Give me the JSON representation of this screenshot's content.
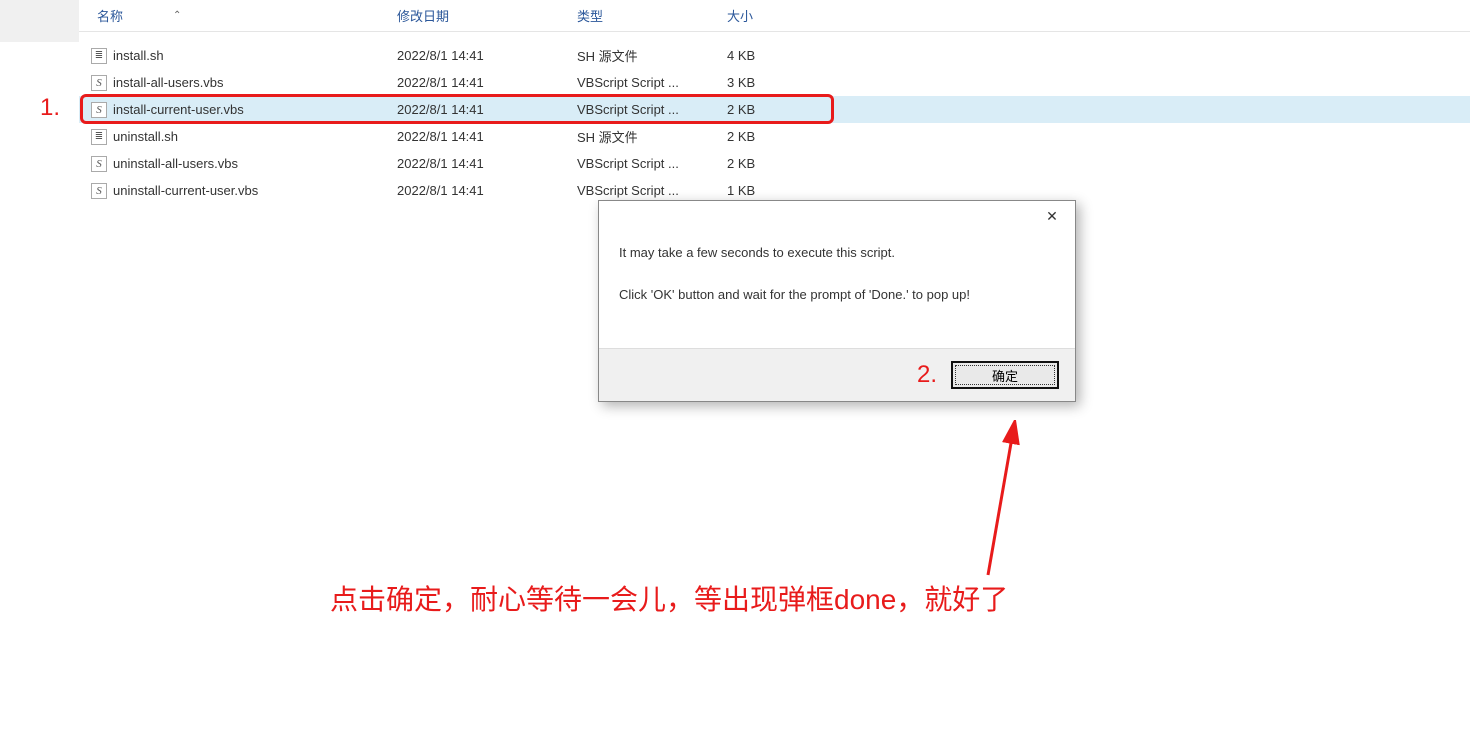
{
  "columns": {
    "name": "名称",
    "date": "修改日期",
    "type": "类型",
    "size": "大小"
  },
  "files": [
    {
      "name": "install.sh",
      "date": "2022/8/1 14:41",
      "type": "SH 源文件",
      "size": "4 KB",
      "icon": "sh"
    },
    {
      "name": "install-all-users.vbs",
      "date": "2022/8/1 14:41",
      "type": "VBScript Script ...",
      "size": "3 KB",
      "icon": "vbs"
    },
    {
      "name": "install-current-user.vbs",
      "date": "2022/8/1 14:41",
      "type": "VBScript Script ...",
      "size": "2 KB",
      "icon": "vbs",
      "selected": true
    },
    {
      "name": "uninstall.sh",
      "date": "2022/8/1 14:41",
      "type": "SH 源文件",
      "size": "2 KB",
      "icon": "sh"
    },
    {
      "name": "uninstall-all-users.vbs",
      "date": "2022/8/1 14:41",
      "type": "VBScript Script ...",
      "size": "2 KB",
      "icon": "vbs"
    },
    {
      "name": "uninstall-current-user.vbs",
      "date": "2022/8/1 14:41",
      "type": "VBScript Script ...",
      "size": "1 KB",
      "icon": "vbs"
    }
  ],
  "dialog": {
    "line1": "It may take a few seconds to execute this script.",
    "line2": "Click 'OK' button and wait for the prompt of 'Done.' to pop up!",
    "ok": "确定"
  },
  "annotations": {
    "num1": "1.",
    "num2": "2.",
    "caption": "点击确定，耐心等待一会儿，等出现弹框done，就好了"
  }
}
